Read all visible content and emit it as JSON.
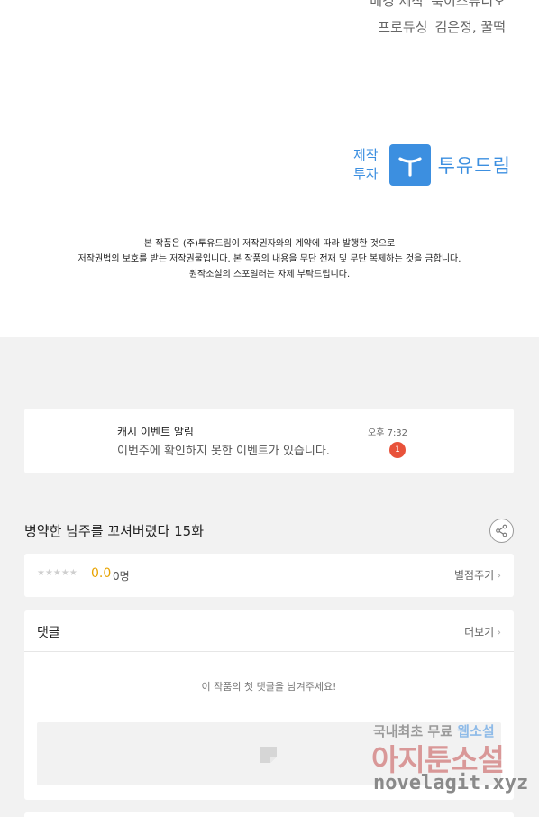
{
  "credits": [
    {
      "role": "배경 제작",
      "value": "룩이즈튜디오"
    },
    {
      "role": "프로듀싱",
      "value": "김은정, 꿀떡"
    }
  ],
  "logo": {
    "role_line1": "제작",
    "role_line2": "투자",
    "name": "투유드림"
  },
  "notice": {
    "line1": "본 작품은 (주)투유드림이 저작권자와의 계약에 따라 발행한 것으로",
    "line2": "저작권법의 보호를 받는 저작권물입니다. 본 작품의 내용을 무단 전재 및 무단 복제하는 것을 금합니다.",
    "line3": "원작소설의 스포일러는 자제 부탁드립니다."
  },
  "alarm": {
    "title": "캐시 이벤트 알림",
    "message": "이번주에 확인하지 못한 이벤트가 있습니다.",
    "time": "오후 7:32",
    "badge_count": "1",
    "badge_color": "#e8523a"
  },
  "episode": {
    "title": "병약한 남주를 꼬셔버렸다 15화"
  },
  "rating": {
    "stars": "★★★★★",
    "stars_filled": 0,
    "score": "0.0",
    "count": "0명",
    "rate_label": "별점주기",
    "chevron": "›",
    "score_color": "#e8a300"
  },
  "comments": {
    "title": "댓글",
    "more_label": "더보기",
    "chevron": "›",
    "empty_message": "이 작품의 첫 댓글을 남겨주세요!"
  },
  "watermark": {
    "line1_a": "국내최초 무료",
    "line1_b": "웹소설",
    "line2": "아지툰소설",
    "line3": "novelagit.xyz"
  },
  "colors": {
    "brand": "#3c8fe0",
    "page_bg": "#f2f2f2"
  }
}
